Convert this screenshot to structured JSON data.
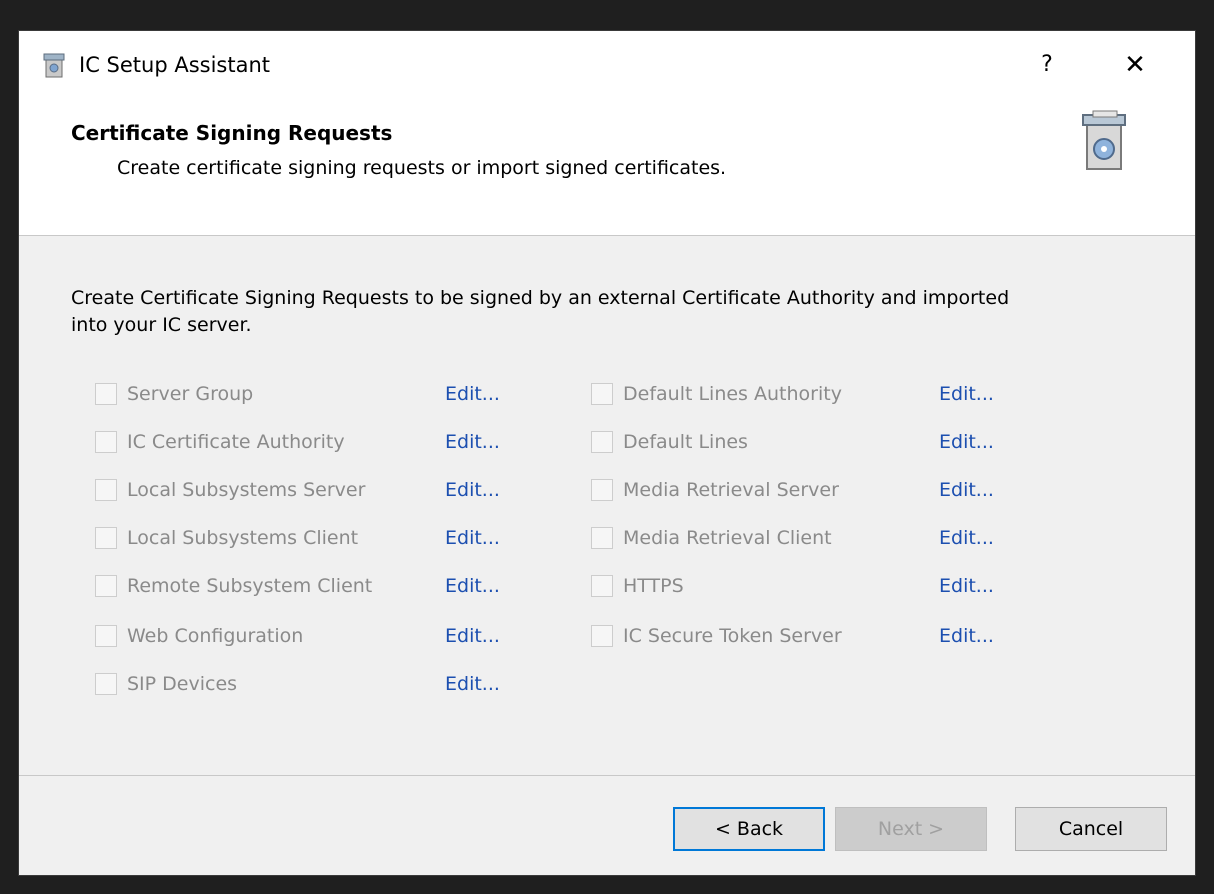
{
  "window": {
    "title": "IC Setup Assistant",
    "help_label": "?",
    "close_label": "✕"
  },
  "header": {
    "title": "Certificate Signing Requests",
    "subtitle": "Create certificate signing requests or import signed certificates."
  },
  "content": {
    "intro": "Create Certificate Signing Requests to be signed by an external Certificate Authority and imported into your IC server."
  },
  "options_left": [
    {
      "label": "Server Group",
      "edit": "Edit...",
      "checked": false
    },
    {
      "label": "IC Certificate Authority",
      "edit": "Edit...",
      "checked": false
    },
    {
      "label": "Local Subsystems Server",
      "edit": "Edit...",
      "checked": false
    },
    {
      "label": "Local Subsystems Client",
      "edit": "Edit...",
      "checked": false
    },
    {
      "label": "Remote Subsystem Client",
      "edit": "Edit...",
      "checked": false
    },
    {
      "label": "Web Configuration",
      "edit": "Edit...",
      "checked": false
    },
    {
      "label": "SIP Devices",
      "edit": "Edit...",
      "checked": false
    }
  ],
  "options_right": [
    {
      "label": "Default Lines Authority",
      "edit": "Edit...",
      "checked": false
    },
    {
      "label": "Default Lines",
      "edit": "Edit...",
      "checked": false
    },
    {
      "label": "Media Retrieval Server",
      "edit": "Edit...",
      "checked": false
    },
    {
      "label": "Media Retrieval Client",
      "edit": "Edit...",
      "checked": false
    },
    {
      "label": "HTTPS",
      "edit": "Edit...",
      "checked": false
    },
    {
      "label": "IC Secure Token Server",
      "edit": "Edit...",
      "checked": false
    }
  ],
  "buttons": {
    "back": "< Back",
    "next": "Next >",
    "cancel": "Cancel"
  },
  "colors": {
    "link": "#1c4fb0",
    "disabled_text": "#8a8a8a",
    "default_button_border": "#0078d7"
  },
  "icons": {
    "title": "setup-assistant-icon",
    "header": "setup-box-graphic"
  }
}
